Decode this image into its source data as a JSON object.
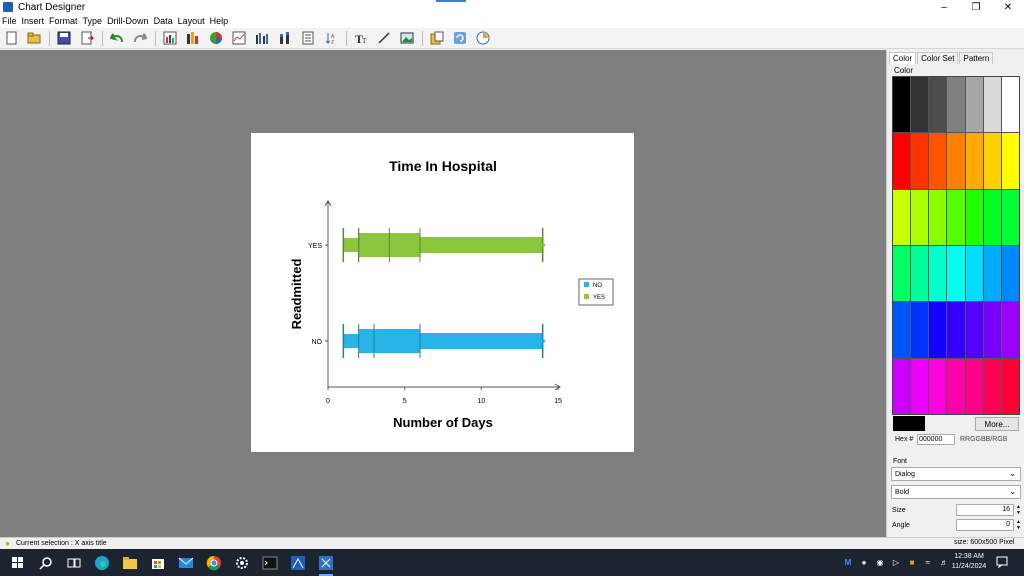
{
  "window": {
    "title": "Chart Designer"
  },
  "menu": [
    "File",
    "Insert",
    "Format",
    "Type",
    "Drill-Down",
    "Data",
    "Layout",
    "Help"
  ],
  "toolbar": {
    "buttons": [
      "new-document-icon",
      "open-folder-icon",
      "save-icon",
      "export-icon",
      "undo-icon",
      "redo-icon",
      "chart-table-icon",
      "bar-chart-icon",
      "pie-chart-icon",
      "line-chart-icon",
      "column-chart-icon",
      "stacked-chart-icon",
      "data-sheet-icon",
      "sort-icon",
      "text-format-icon",
      "draw-line-icon",
      "insert-image-icon",
      "paste-chart-icon",
      "refresh-icon",
      "chart-wizard-icon"
    ]
  },
  "chart_data": {
    "type": "box",
    "title": "Time In Hospital",
    "xlabel": "Number of Days",
    "ylabel": "Readmitted",
    "xlim": [
      0,
      15
    ],
    "xticks": [
      0,
      5,
      10,
      15
    ],
    "categories": [
      "NO",
      "YES"
    ],
    "series": [
      {
        "name": "NO",
        "color": "#29b3e6",
        "values": {
          "whisker_low": 1,
          "p10": 2,
          "q1": 3,
          "median": 3,
          "q3": 6,
          "whisker_high": 14
        }
      },
      {
        "name": "YES",
        "color": "#8cc63f",
        "values": {
          "whisker_low": 1,
          "p10": 2,
          "q1": 2,
          "median": 4,
          "q3": 6,
          "whisker_high": 14
        }
      }
    ],
    "legend": [
      "NO",
      "YES"
    ],
    "legend_position": "right",
    "grid": false
  },
  "panel": {
    "tabs": [
      "Color",
      "Color Set",
      "Pattern"
    ],
    "active_tab": "Color",
    "color_group_label": "Color",
    "palette": [
      "#000000",
      "#333333",
      "#4d4d4d",
      "#808080",
      "#a6a6a6",
      "#d9d9d9",
      "#ffffff",
      "#ff0000",
      "#ff3300",
      "#ff5500",
      "#ff8000",
      "#ffaa00",
      "#ffd000",
      "#ffff00",
      "#ccff00",
      "#aaff00",
      "#88ff00",
      "#55ff00",
      "#22ff00",
      "#00ff22",
      "#00ff33",
      "#00ff66",
      "#00ff99",
      "#00ffcc",
      "#00ffee",
      "#00ddff",
      "#00aaff",
      "#0088ff",
      "#0055ff",
      "#0033ff",
      "#1100ff",
      "#3300ff",
      "#5500ff",
      "#7700ff",
      "#9900ff",
      "#cc00ff",
      "#ee00ff",
      "#ff00dd",
      "#ff00aa",
      "#ff0088",
      "#ff0055",
      "#ff0033"
    ],
    "current_color": "#000000",
    "more_label": "More...",
    "hex_label": "Hex #",
    "hex_value": "000000",
    "hex_hint": "RRGGBB/RGB",
    "font_label": "Font",
    "font_family": "Dialog",
    "font_style": "Bold",
    "size_label": "Size",
    "size_value": "16",
    "angle_label": "Angle",
    "angle_value": "0",
    "canvas_size": "size: 600x500 Pixel"
  },
  "status": {
    "selection": "Current selection : X axis title"
  },
  "taskbar": {
    "apps": [
      "windows-start-icon",
      "search-icon",
      "task-view-icon",
      "edge-browser-icon",
      "file-explorer-icon",
      "store-icon",
      "mail-icon",
      "chrome-icon",
      "settings-gear-icon",
      "terminal-icon",
      "chart-app-icon",
      "chart-designer-icon"
    ],
    "time": "12:38 AM",
    "date": "11/24/2024"
  }
}
